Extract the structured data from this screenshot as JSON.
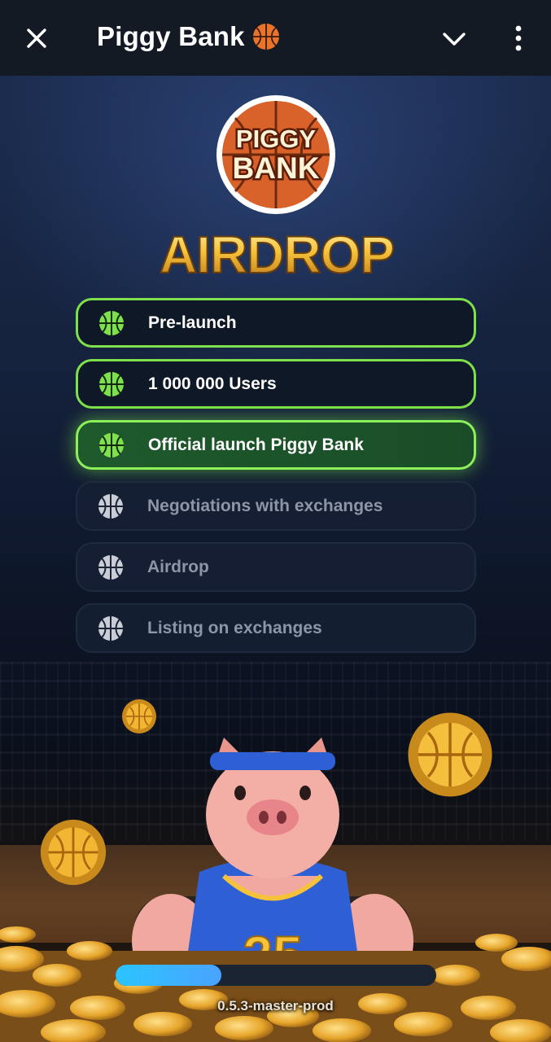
{
  "header": {
    "title": "Piggy Bank",
    "title_icon": "basketball-icon",
    "close_icon": "close-icon",
    "collapse_icon": "chevron-down-icon",
    "menu_icon": "more-vertical-icon"
  },
  "logo": {
    "line1": "PIGGY",
    "line2": "BANK",
    "headline": "AIRDROP"
  },
  "roadmap": [
    {
      "label": "Pre-launch",
      "status": "done",
      "icon": "basketball-icon"
    },
    {
      "label": "1 000 000 Users",
      "status": "done",
      "icon": "basketball-icon"
    },
    {
      "label": "Official launch Piggy Bank",
      "status": "active",
      "icon": "basketball-icon"
    },
    {
      "label": "Negotiations with exchanges",
      "status": "pending",
      "icon": "basketball-icon"
    },
    {
      "label": "Airdrop",
      "status": "pending",
      "icon": "basketball-icon"
    },
    {
      "label": "Listing on exchanges",
      "status": "pending",
      "icon": "basketball-icon"
    }
  ],
  "mascot": {
    "jersey_number": "25"
  },
  "loading": {
    "progress_fraction": 0.33
  },
  "footer": {
    "version": "0.5.3-master-prod"
  },
  "colors": {
    "accent_green": "#7ee04a",
    "active_fill": "#1e5a2c",
    "progress": "#2bc4ff",
    "gold": "#f2b632"
  }
}
